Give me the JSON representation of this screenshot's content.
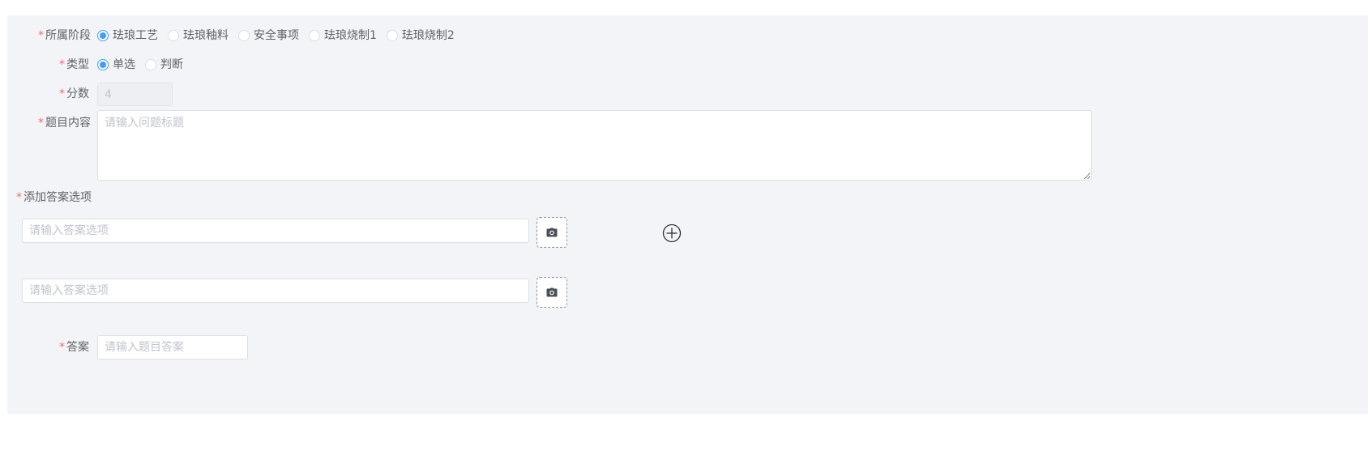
{
  "form": {
    "stage": {
      "required_mark": "*",
      "label": "所属阶段",
      "options": [
        "珐琅工艺",
        "珐琅釉料",
        "安全事项",
        "珐琅烧制1",
        "珐琅烧制2"
      ],
      "selected": "珐琅工艺"
    },
    "type": {
      "required_mark": "*",
      "label": "类型",
      "options": [
        "单选",
        "判断"
      ],
      "selected": "单选"
    },
    "score": {
      "required_mark": "*",
      "label": "分数",
      "value": "4"
    },
    "content": {
      "required_mark": "*",
      "label": "题目内容",
      "placeholder": "请输入问题标题",
      "value": ""
    },
    "options_section": {
      "required_mark": "*",
      "label": "添加答案选项",
      "items": [
        {
          "placeholder": "请输入答案选项",
          "value": ""
        },
        {
          "placeholder": "请输入答案选项",
          "value": ""
        }
      ]
    },
    "answer": {
      "required_mark": "*",
      "label": "答案",
      "placeholder": "请输入题目答案",
      "value": ""
    }
  },
  "icons": {
    "upload": "camera-icon",
    "add": "plus-circle-icon"
  },
  "colors": {
    "accent": "#409eff",
    "required": "#f56c6c",
    "panel_bg": "#f2f4f7"
  }
}
